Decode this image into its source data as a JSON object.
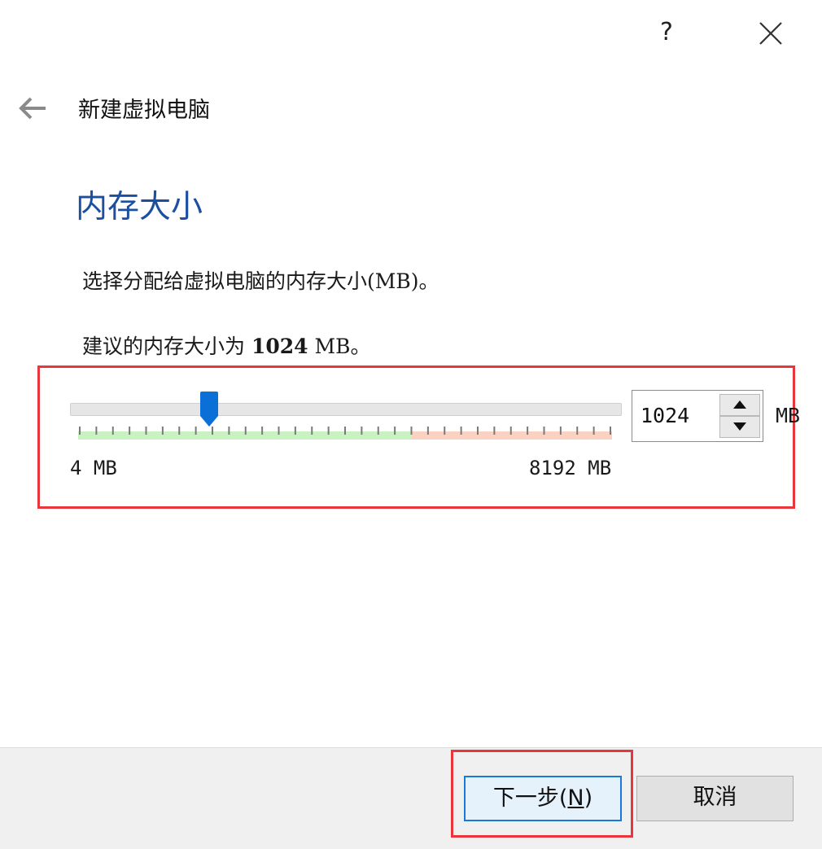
{
  "window": {
    "help_label": "?",
    "close_icon": "close-icon",
    "back_icon": "back-arrow-icon"
  },
  "wizard": {
    "title": "新建虚拟电脑"
  },
  "page": {
    "heading": "内存大小",
    "description": "选择分配给虚拟电脑的内存大小(MB)。",
    "recommend_prefix": "建议的内存大小为 ",
    "recommend_value": "1024",
    "recommend_suffix": " MB。"
  },
  "memory": {
    "value": 1024,
    "value_text": "1024",
    "min": 4,
    "max": 8192,
    "min_label": "4 MB",
    "max_label": "8192 MB",
    "unit": "MB",
    "ticks": 33,
    "green_until_fraction": 0.625,
    "colors": {
      "safe": "#c8f2c0",
      "warn": "#fbd2c2",
      "danger": "#f9c6c6",
      "handle": "#0a6fd6",
      "tick": "#7a7a7a"
    }
  },
  "footer": {
    "next_label": "下一步(",
    "next_mnemonic": "N",
    "next_suffix": ")",
    "cancel_label": "取消"
  },
  "annotations": {
    "highlight_color": "#e8363c"
  }
}
